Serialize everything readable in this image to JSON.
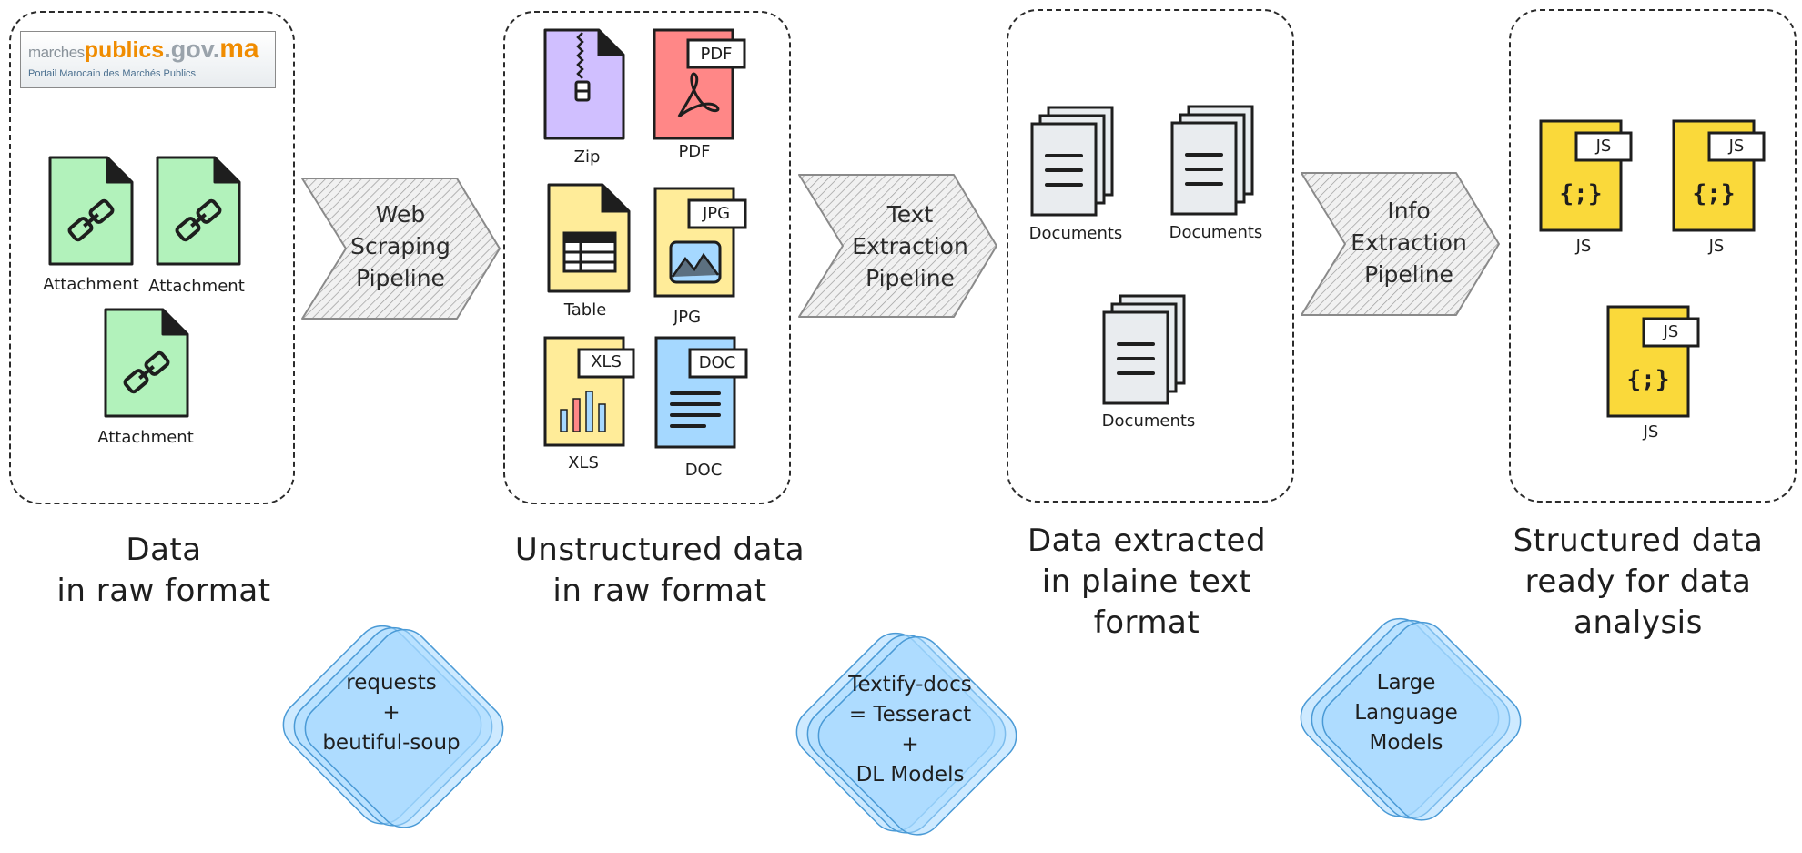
{
  "logo": {
    "main_prefix": "marches",
    "main_mid": "publics",
    "main_suffix": ".gov.",
    "main_tld": "ma",
    "subtitle": "Portail Marocain des Marchés Publics"
  },
  "stages": [
    {
      "label_line1": "Data",
      "label_line2": "in raw format"
    },
    {
      "label_line1": "Unstructured data",
      "label_line2": "in raw format"
    },
    {
      "label_line1": "Data extracted",
      "label_line2": "in plaine text",
      "label_line3": "format"
    },
    {
      "label_line1": "Structured data",
      "label_line2": "ready for data",
      "label_line3": "analysis"
    }
  ],
  "attachments": [
    "Attachment",
    "Attachment",
    "Attachment"
  ],
  "files": {
    "zip": "Zip",
    "pdf": "PDF",
    "pdf_tag": "PDF",
    "table": "Table",
    "jpg": "JPG",
    "jpg_tag": "JPG",
    "xls": "XLS",
    "xls_tag": "XLS",
    "doc": "DOC",
    "doc_tag": "DOC"
  },
  "documents": [
    "Documents",
    "Documents",
    "Documents"
  ],
  "js_files": [
    {
      "label": "JS",
      "tag": "JS",
      "glyph": "{;}"
    },
    {
      "label": "JS",
      "tag": "JS",
      "glyph": "{;}"
    },
    {
      "label": "JS",
      "tag": "JS",
      "glyph": "{;}"
    }
  ],
  "pipelines": [
    {
      "line1": "Web",
      "line2": "Scraping",
      "line3": "Pipeline"
    },
    {
      "line1": "Text",
      "line2": "Extraction",
      "line3": "Pipeline"
    },
    {
      "line1": "Info",
      "line2": "Extraction",
      "line3": "Pipeline"
    }
  ],
  "tools": [
    {
      "line1": "requests",
      "line2": "+",
      "line3": "beutiful-soup"
    },
    {
      "line1": "Textify-docs",
      "line2": "= Tesseract",
      "line3": "+",
      "line4": "DL Models"
    },
    {
      "line1": "Large",
      "line2": "Language",
      "line3": "Models"
    }
  ],
  "colors": {
    "attachment_green": "#b2f2bb",
    "zip_purple": "#d0bfff",
    "pdf_red": "#ff8787",
    "yellow_file": "#ffec99",
    "doc_blue": "#a5d8ff",
    "doc_gray": "#e9ecef",
    "js_yellow": "#fad93a",
    "diamond_blue": "#a5d8ff",
    "logo_orange": "#f08c00",
    "logo_gray": "#9aa3ab"
  }
}
